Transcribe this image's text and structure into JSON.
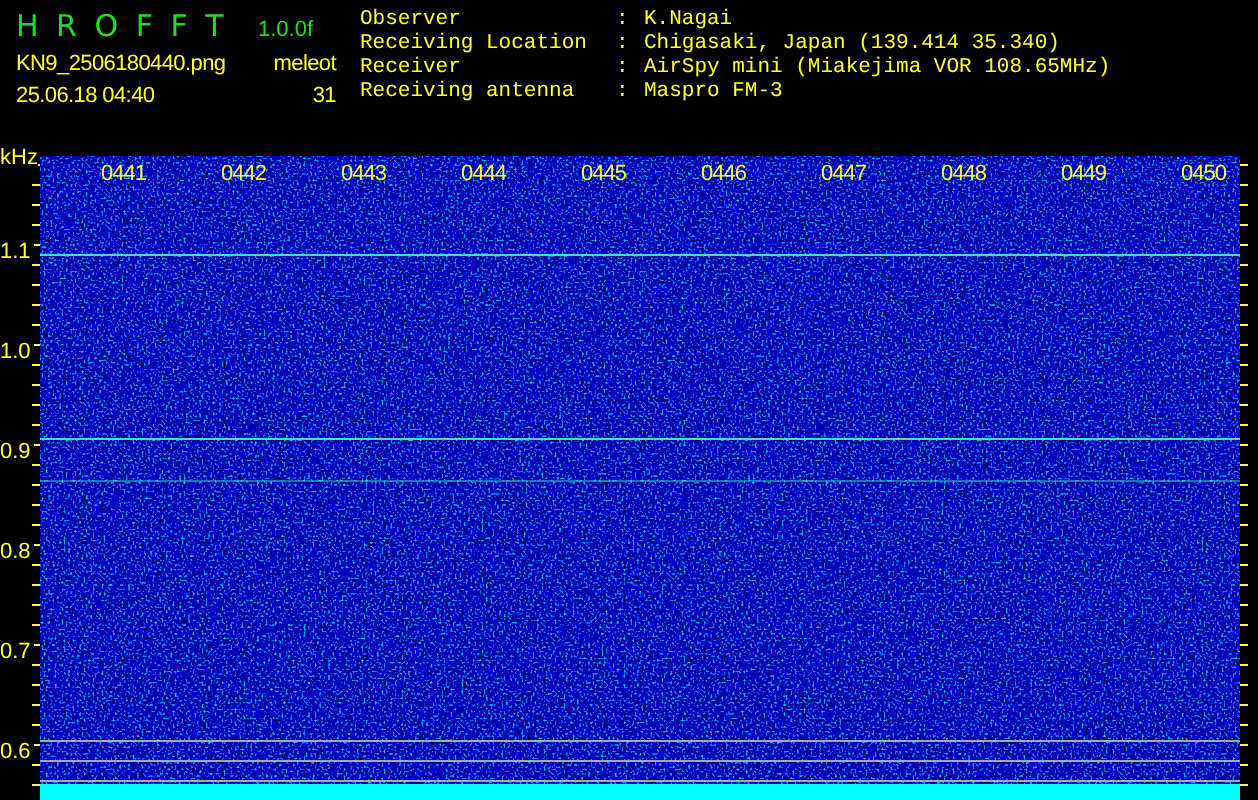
{
  "header": {
    "program": "H R O F F T",
    "version": "1.0.0f",
    "file_name": "KN9_2506180440.png",
    "mode": "meleot",
    "timestamp": "25.06.18 04:40",
    "count": "31"
  },
  "info": [
    {
      "label": "Observer",
      "separator": ":",
      "value": "K.Nagai"
    },
    {
      "label": "Receiving Location",
      "separator": ":",
      "value": "Chigasaki, Japan (139.414 35.340)"
    },
    {
      "label": "Receiver",
      "separator": ":",
      "value": "AirSpy mini (Miakejima VOR 108.65MHz)"
    },
    {
      "label": "Receiving antenna",
      "separator": ":",
      "value": "Maspro FM-3"
    }
  ],
  "spectrogram": {
    "y_unit": "kHz",
    "y_labels": [
      "1.1",
      "1.0",
      "0.9",
      "0.8",
      "0.7",
      "0.6"
    ],
    "time_labels": [
      "0441",
      "0442",
      "0443",
      "0444",
      "0445",
      "0446",
      "0447",
      "0448",
      "0449",
      "0450"
    ]
  }
}
